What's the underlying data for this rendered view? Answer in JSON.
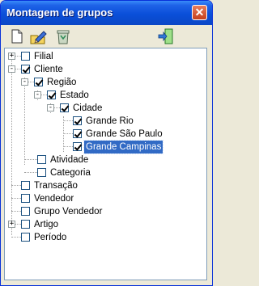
{
  "window": {
    "title": "Montagem de grupos"
  },
  "toolbar": {
    "buttons": [
      {
        "name": "new-document-icon"
      },
      {
        "name": "edit-pencil-icon"
      },
      {
        "name": "recycle-bin-icon"
      },
      {
        "name": "exit-door-icon"
      }
    ]
  },
  "tree": {
    "items": [
      {
        "label": "Filial",
        "checked": false,
        "expander": "+"
      },
      {
        "label": "Cliente",
        "checked": true,
        "expander": "-"
      },
      {
        "label": "Região",
        "checked": true,
        "expander": "-"
      },
      {
        "label": "Estado",
        "checked": true,
        "expander": "-"
      },
      {
        "label": "Cidade",
        "checked": true,
        "expander": "-"
      },
      {
        "label": "Grande Rio",
        "checked": true
      },
      {
        "label": "Grande São Paulo",
        "checked": true
      },
      {
        "label": "Grande Campinas",
        "checked": true,
        "selected": true
      },
      {
        "label": "Atividade",
        "checked": false
      },
      {
        "label": "Categoria",
        "checked": false
      },
      {
        "label": "Transação",
        "checked": false
      },
      {
        "label": "Vendedor",
        "checked": false
      },
      {
        "label": "Grupo Vendedor",
        "checked": false
      },
      {
        "label": "Artigo",
        "checked": false,
        "expander": "+"
      },
      {
        "label": "Período",
        "checked": false
      }
    ]
  }
}
